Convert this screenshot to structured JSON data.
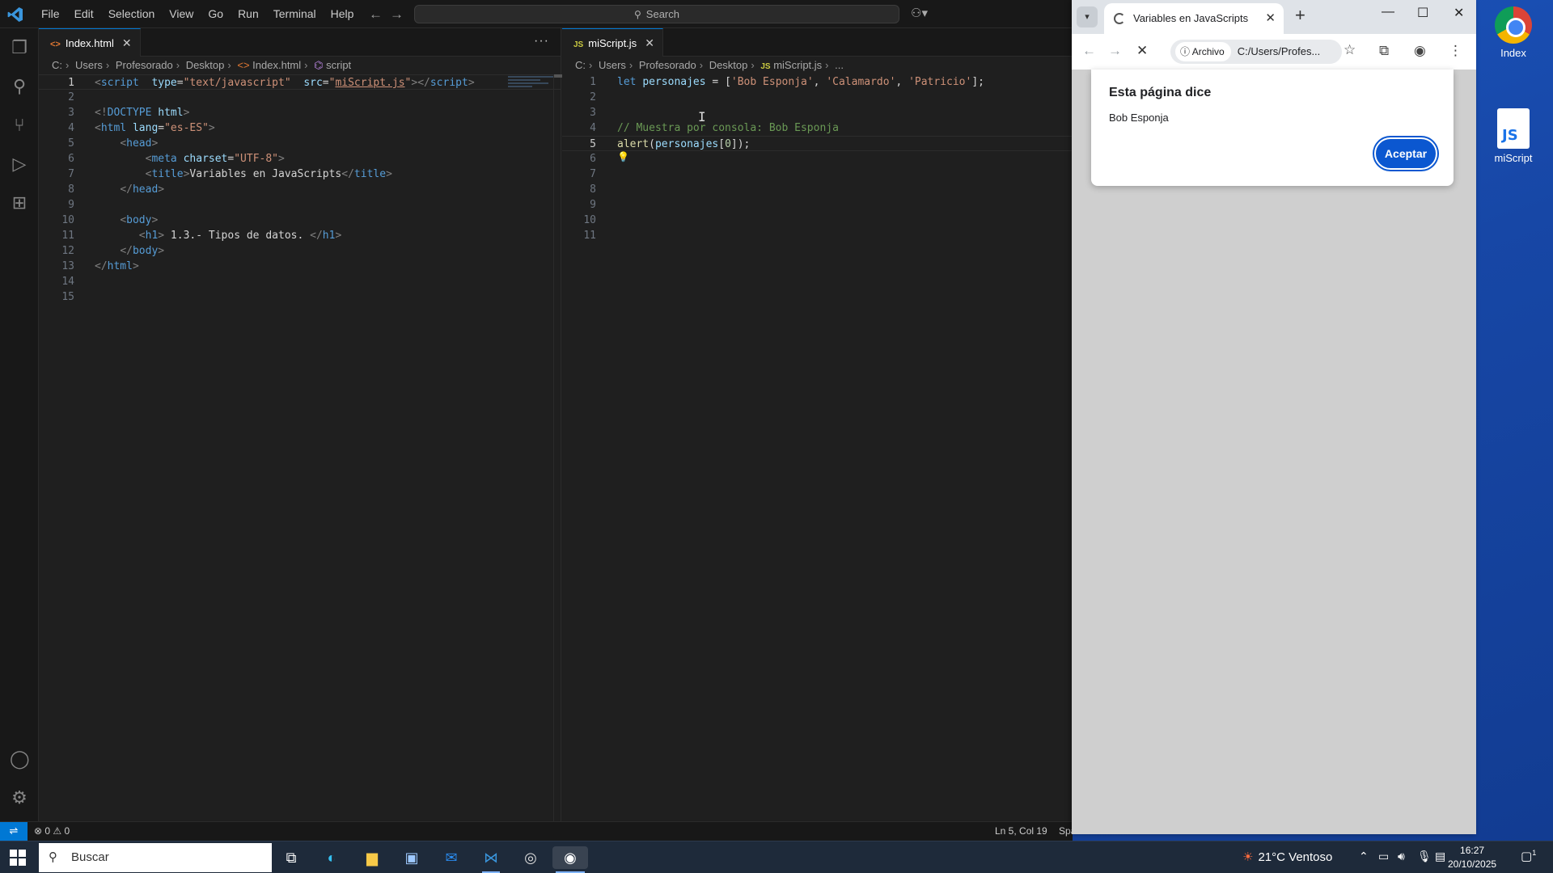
{
  "desktop": {
    "icons": [
      {
        "label": "Index",
        "icon": "chrome-icon"
      },
      {
        "label": "miScript",
        "icon": "js-file-icon",
        "glyph": "JS"
      }
    ]
  },
  "vscode": {
    "menu": [
      "File",
      "Edit",
      "Selection",
      "View",
      "Go",
      "Run",
      "Terminal",
      "Help"
    ],
    "command_center": "Search",
    "left_group": {
      "tab": {
        "icon": "<>",
        "label": "Index.html"
      },
      "breadcrumb": [
        "C:",
        "Users",
        "Profesorado",
        "Desktop",
        "Index.html",
        "script"
      ],
      "more": "···"
    },
    "right_group": {
      "tab": {
        "icon": "JS",
        "label": "miScript.js"
      },
      "breadcrumb": [
        "C:",
        "Users",
        "Profesorado",
        "Desktop",
        "miScript.js",
        "..."
      ]
    },
    "status": {
      "problems": "⊗ 0 ⚠ 0",
      "cursor": "Ln 5, Col 19",
      "spaces": "Spa"
    }
  },
  "chrome": {
    "tab_title": "Variables en JavaScripts",
    "omnibox_chip": "Archivo",
    "url": "C:/Users/Profes...",
    "dialog": {
      "title": "Esta página dice",
      "message": "Bob Esponja",
      "ok": "Aceptar"
    }
  },
  "taskbar": {
    "search_placeholder": "Buscar",
    "weather": "21°C  Ventoso",
    "time": "16:27",
    "date": "20/10/2025",
    "notifications": "1"
  },
  "colors": {
    "accent": "#0078d4",
    "chrome_button": "#0b57d0",
    "desktop": "#1f5fd0"
  }
}
